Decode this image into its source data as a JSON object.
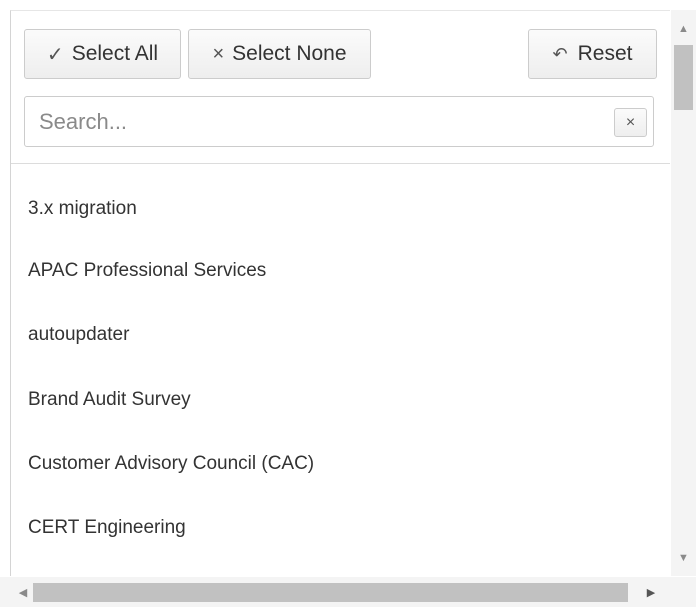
{
  "toolbar": {
    "select_all": {
      "icon": "checkmark-icon",
      "glyph": "✓",
      "label": "Select All"
    },
    "select_none": {
      "icon": "times-icon",
      "glyph": "×",
      "label": "Select None"
    },
    "reset": {
      "icon": "undo-icon",
      "glyph": "↶",
      "label": "Reset"
    }
  },
  "search": {
    "placeholder": "Search...",
    "value": "",
    "clear_glyph": "×"
  },
  "list": {
    "items": [
      {
        "label": "3.x migration"
      },
      {
        "label": "APAC Professional Services"
      },
      {
        "label": "autoupdater"
      },
      {
        "label": "Brand Audit Survey"
      },
      {
        "label": "Customer Advisory Council (CAC)"
      },
      {
        "label": "CERT Engineering"
      }
    ]
  },
  "scrollbars": {
    "vertical": {
      "up_glyph": "▲",
      "down_glyph": "▼"
    },
    "horizontal": {
      "left_glyph": "◀",
      "right_glyph": "▶"
    }
  }
}
